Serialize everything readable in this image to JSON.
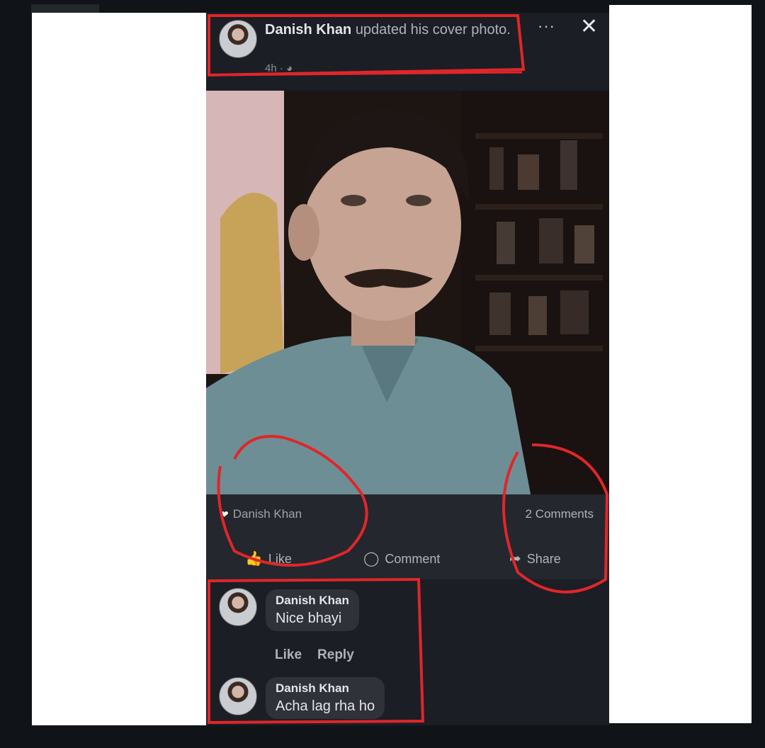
{
  "post": {
    "author": "Danish Khan",
    "action": "updated his cover photo.",
    "time": "4h · ",
    "globe_icon": "globe-icon",
    "more_icon": "more-icon",
    "close_icon": "close-icon"
  },
  "reactions": {
    "reactor": "Danish Khan",
    "comments_count": "2 Comments"
  },
  "actions": {
    "like": "Like",
    "comment": "Comment",
    "share": "Share"
  },
  "comments": [
    {
      "name": "Danish Khan",
      "text": "Nice bhayi",
      "like": "Like",
      "reply": "Reply"
    },
    {
      "name": "Danish Khan",
      "text": "Acha lag rha ho"
    }
  ],
  "colors": {
    "page_background": "#101418",
    "panel_white": "#ffffff",
    "phone_background": "#1b1e24",
    "annotation_red": "#e0262a"
  }
}
